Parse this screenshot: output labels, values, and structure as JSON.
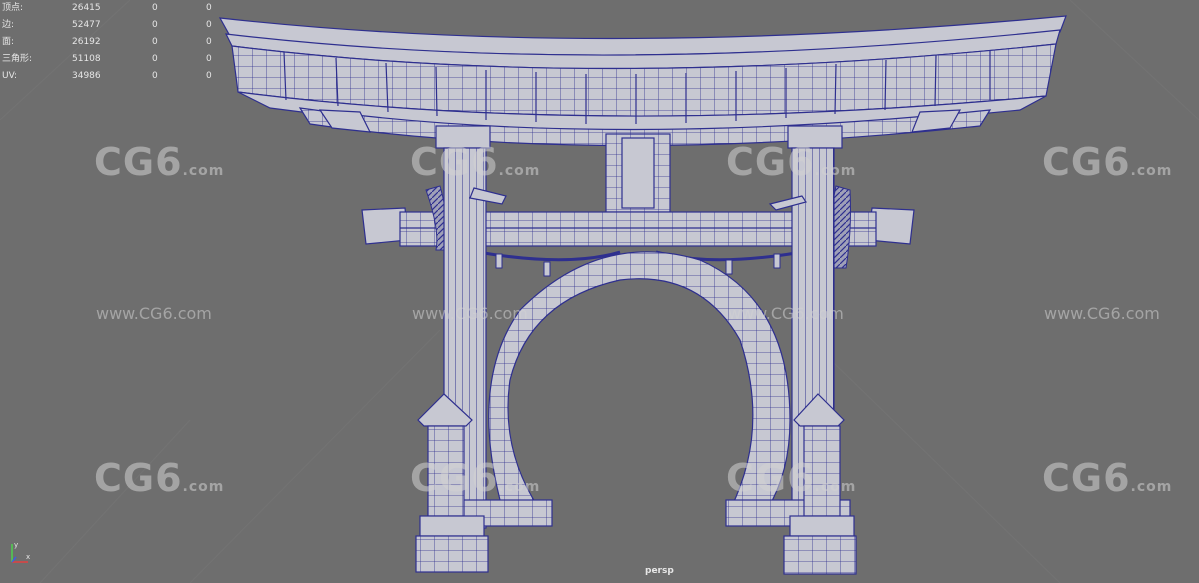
{
  "hud": {
    "rows": [
      {
        "label": "顶点:",
        "total": "26415",
        "selected": "0",
        "uv": "0"
      },
      {
        "label": "边:",
        "total": "52477",
        "selected": "0",
        "uv": "0"
      },
      {
        "label": "面:",
        "total": "26192",
        "selected": "0",
        "uv": "0"
      },
      {
        "label": "三角形:",
        "total": "51108",
        "selected": "0",
        "uv": "0"
      },
      {
        "label": "UV:",
        "total": "34986",
        "selected": "0",
        "uv": "0"
      }
    ]
  },
  "viewport": {
    "camera": "persp",
    "background": "#6e6e6e",
    "wireframe_color": "#2e2f8f",
    "surface_color": "#c7c8d2"
  },
  "watermark": {
    "logo": "CG6",
    "logo_suffix": ".com",
    "url": "www.CG6.com"
  },
  "axis": {
    "y_label": "y",
    "x_label": "x"
  }
}
